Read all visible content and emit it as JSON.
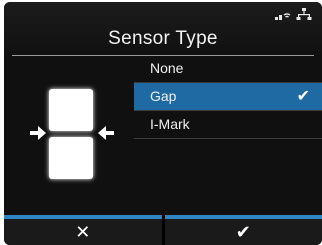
{
  "header": {
    "title": "Sensor Type",
    "status_icons": [
      "wireless-icon",
      "network-icon"
    ]
  },
  "options": [
    {
      "label": "None",
      "selected": false
    },
    {
      "label": "Gap",
      "selected": true
    },
    {
      "label": "I-Mark",
      "selected": false
    }
  ],
  "selected_marker": "✔",
  "softkeys": {
    "cancel": "✕",
    "confirm": "✔"
  },
  "colors": {
    "accent": "#1f6aa3",
    "softkey_bar": "#2f86c5",
    "background": "#101010"
  }
}
